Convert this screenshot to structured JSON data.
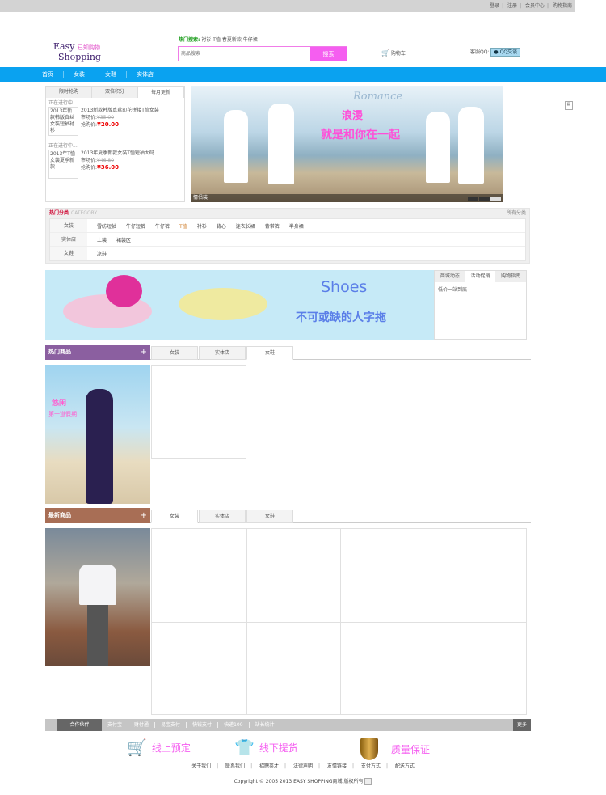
{
  "topbar": {
    "links": [
      "登录",
      "注册",
      "会员中心",
      "购物指南"
    ]
  },
  "logo": {
    "line1": "Easy",
    "line2": "Shopping",
    "cn": "已知购物"
  },
  "hot_search": {
    "label": "热门搜索:",
    "terms": [
      "衬衫",
      "T恤",
      "春夏新款",
      "牛仔裙"
    ]
  },
  "search": {
    "placeholder": "商品搜索",
    "button": "搜索"
  },
  "cart": {
    "label": "购物车"
  },
  "qq": {
    "label": "客服QQ:",
    "button": "QQ交谈"
  },
  "nav": [
    "首页",
    "女装",
    "女鞋",
    "实体店"
  ],
  "deals": {
    "tabs": [
      "限时抢购",
      "双倍积分",
      "每月更新"
    ],
    "items": [
      {
        "status": "正在进行中...",
        "thumb": "2013年新款韩版真丝女装短袖衬衫",
        "title": "2013新款韩版真丝印花拼接T恤女装",
        "market_label": "市场价:",
        "market": "¥35.00",
        "price_label": "抢购价:",
        "price": "¥20.00"
      },
      {
        "status": "正在进行中...",
        "thumb": "2013年T恤女装夏季新款",
        "title": "2013年夏季新款女装T恤短袖大码",
        "market_label": "市场价:",
        "market": "¥46.80",
        "price_label": "抢购价:",
        "price": "¥36.00"
      }
    ]
  },
  "banner": {
    "en": "Romance",
    "t1": "浪漫",
    "t2": "就是和你在一起",
    "caption": "情侣装"
  },
  "category": {
    "title": "热门分类",
    "en": "CATEGORY",
    "all": "所有分类",
    "rows": [
      {
        "key": "女装",
        "items": [
          "雪纺短袖",
          "牛仔短裤",
          "牛仔裤",
          "T恤",
          "衬衫",
          "背心",
          "连衣长裙",
          "背带裤",
          "半身裙"
        ]
      },
      {
        "key": "实体店",
        "items": [
          "上装",
          "裙装区"
        ]
      },
      {
        "key": "女鞋",
        "items": [
          "凉鞋"
        ]
      }
    ]
  },
  "shoes_ad": {
    "title": "Shoes",
    "subtitle": "不可或缺的人字拖"
  },
  "side_tabs": {
    "tabs": [
      "商城动态",
      "活动促销",
      "购物指南"
    ],
    "content": "低价一站到底"
  },
  "hot_goods": {
    "title": "热门商品",
    "plus": "+",
    "tabs": [
      "女装",
      "实体店",
      "女鞋"
    ],
    "active": 2,
    "pic_text1": "悠闲",
    "pic_text2": "第一道假期"
  },
  "new_goods": {
    "title": "最新商品",
    "plus": "+",
    "tabs": [
      "女装",
      "实体店",
      "女鞋"
    ],
    "active": 0
  },
  "partners": {
    "title": "合作伙伴",
    "links": [
      "支付宝",
      "财付通",
      "易宝支付",
      "快钱支付",
      "快递100",
      "站长统计"
    ],
    "more": "更多"
  },
  "promises": [
    "线上预定",
    "线下提货",
    "质量保证"
  ],
  "footer_links": [
    "关于我们",
    "联系我们",
    "招聘英才",
    "法律声明",
    "友情链接",
    "支付方式",
    "配送方式"
  ],
  "copyright": "Copyright © 2005 2013 EASY SHOPPING商城 版权所有",
  "colors": {
    "nav": "#0aa2f0",
    "search": "#f55ef0",
    "hot": "#8b5fa0",
    "new": "#a86e55",
    "price": "#ee0000"
  }
}
